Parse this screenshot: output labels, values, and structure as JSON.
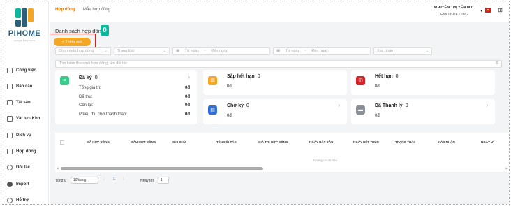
{
  "app": {
    "brand": "PIHOME",
    "brand_sub": "Living for living happily"
  },
  "sidebar": {
    "items": [
      {
        "label": "Công việc",
        "icon": "task-icon"
      },
      {
        "label": "Báo cáo",
        "icon": "report-icon"
      },
      {
        "label": "Tài sản",
        "icon": "asset-icon"
      },
      {
        "label": "Vật tư - Kho",
        "icon": "warehouse-icon"
      },
      {
        "label": "Dịch vụ",
        "icon": "service-icon"
      },
      {
        "label": "Hợp đồng",
        "icon": "folder-icon"
      },
      {
        "label": "Đối tác",
        "icon": "partner-icon"
      },
      {
        "label": "Import",
        "icon": "cloud-upload-icon"
      },
      {
        "label": "Hỗ trợ",
        "icon": "support-icon"
      }
    ]
  },
  "header": {
    "tabs": [
      {
        "label": "Hợp đồng",
        "active": true
      },
      {
        "label": "Mẫu hợp đồng",
        "active": false
      }
    ],
    "user_name": "NGUYỄN THỊ YẾN MY",
    "building": "DEMO BUILDING",
    "caret": "▾",
    "apps_icon": "⊞"
  },
  "page": {
    "title": "Danh sách hợp đồng",
    "count": "0",
    "add_button": "+ Thêm mới"
  },
  "filters": {
    "template_placeholder": "Chọn mẫu hợp đồng",
    "status_placeholder": "Trạng thái",
    "from_date_1": "Từ ngày",
    "to_date_1": "Đến ngày",
    "from_date_2": "Từ ngày",
    "to_date_2": "Đến ngày",
    "confirm_placeholder": "Xác nhận",
    "search_placeholder": "Tìm kiếm theo mã hợp đồng, tên đối tác"
  },
  "cards": {
    "signed": {
      "title": "Đã ký",
      "count": "0",
      "rows": [
        {
          "label": "Tổng giá trị:",
          "value": "0đ"
        },
        {
          "label": "Đã thu:",
          "value": "0đ"
        },
        {
          "label": "Còn lại:",
          "value": "0đ"
        },
        {
          "label": "Phiếu thu chờ thanh toán:",
          "value": "0đ"
        }
      ]
    },
    "expiring": {
      "title": "Sắp hết hạn",
      "count": "0",
      "value": "0đ"
    },
    "expired": {
      "title": "Hết hạn",
      "count": "0",
      "value": "0đ"
    },
    "pending": {
      "title": "Chờ ký",
      "count": "0",
      "value": "0đ"
    },
    "liquidated": {
      "title": "Đã Thanh lý",
      "count": "0",
      "value": "0đ"
    },
    "arrow": "›"
  },
  "table": {
    "columns": [
      "MÃ HỢP ĐỒNG",
      "MẪU HỢP ĐỒNG",
      "GHI CHÚ",
      "TÊN ĐỐI TÁC",
      "GIÁ TRỊ HỢP ĐỒNG",
      "NGÀY BẮT ĐẦU",
      "NGÀY KẾT THÚC",
      "TRẠNG THÁI",
      "XÁC NHẬN",
      "NGÀY Ư"
    ],
    "empty_text": "Không có dữ liệu"
  },
  "pagination": {
    "total": "Tổng 0",
    "per_page": "10/trang",
    "prev": "‹",
    "page": "1",
    "next": "›",
    "goto_label": "Nhảy tới",
    "goto_value": "1"
  },
  "colors": {
    "accent": "#e87d0d",
    "add_button": "#f5a623",
    "badge": "#0bb89b",
    "highlight": "#e31b1b"
  }
}
